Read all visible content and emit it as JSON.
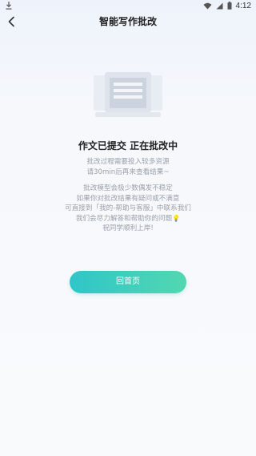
{
  "status_bar": {
    "time": "4:12",
    "icons": [
      "download-icon",
      "wifi-icon",
      "signal-icon",
      "battery-icon"
    ]
  },
  "nav": {
    "title": "智能写作批改",
    "back_icon": "chevron-left-icon"
  },
  "content": {
    "illustration": "document-laptop-illustration",
    "heading": "作文已提交 正在批改中",
    "sub_lines": [
      "批改过程需要投入较多资源",
      "请30min后再来查看结果~"
    ],
    "note_lines": [
      "批改模型会极少数偶发不稳定",
      "如果你对批改结果有疑问或不满意",
      "可直接到「我的-帮助与客服」中联系我们",
      "我们会尽力解答和帮助你的问题",
      "祝同学顺利上岸!"
    ],
    "note_emoji": "💡"
  },
  "actions": {
    "home_label": "回首页"
  },
  "colors": {
    "button_gradient_start": "#2fc6c8",
    "button_gradient_end": "#52d7b0",
    "subtext": "#9aa0aa"
  }
}
